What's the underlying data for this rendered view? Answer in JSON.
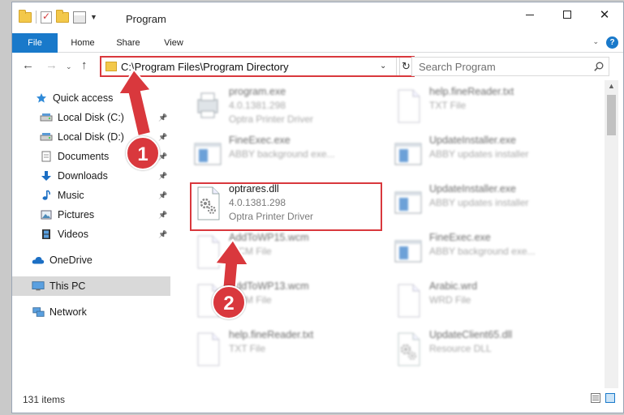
{
  "window": {
    "title": "Program",
    "icons": [
      "folder-icon",
      "properties-check-icon",
      "new-folder-icon",
      "properties-icon",
      "customize-chevron-icon"
    ]
  },
  "ribbon": {
    "tabs": [
      "File",
      "Home",
      "Share",
      "View"
    ],
    "help": "?"
  },
  "address": {
    "path": "C:\\Program Files\\Program Directory",
    "dropdown": "⌄",
    "refresh": "↻"
  },
  "search": {
    "placeholder": "Search Program"
  },
  "sidebar": {
    "items": [
      {
        "label": "Quick access",
        "icon": "star-icon",
        "pinned": false
      },
      {
        "label": "Local Disk (C:)",
        "icon": "drive-icon",
        "pinned": true
      },
      {
        "label": "Local Disk (D:)",
        "icon": "drive-icon",
        "pinned": true
      },
      {
        "label": "Documents",
        "icon": "documents-icon",
        "pinned": true
      },
      {
        "label": "Downloads",
        "icon": "download-arrow-icon",
        "pinned": true
      },
      {
        "label": "Music",
        "icon": "music-note-icon",
        "pinned": true
      },
      {
        "label": "Pictures",
        "icon": "pictures-icon",
        "pinned": true
      },
      {
        "label": "Videos",
        "icon": "video-film-icon",
        "pinned": true
      },
      {
        "label": "OneDrive",
        "icon": "cloud-icon",
        "pinned": false
      },
      {
        "label": "This PC",
        "icon": "computer-icon",
        "pinned": false,
        "selected": true
      },
      {
        "label": "Network",
        "icon": "network-icon",
        "pinned": false
      }
    ]
  },
  "files": [
    {
      "name": "program.exe",
      "version": "4.0.1381.298",
      "desc": "Optra Printer Driver",
      "icon": "printer-exe-icon"
    },
    {
      "name": "help.fineReader.txt",
      "version": "TXT File",
      "desc": "",
      "icon": "text-file-icon"
    },
    {
      "name": "FineExec.exe",
      "version": "ABBY background exe...",
      "desc": "",
      "icon": "app-window-icon"
    },
    {
      "name": "UpdateInstaller.exe",
      "version": "ABBY updates installer",
      "desc": "",
      "icon": "app-window-icon"
    },
    {
      "name": "optrares.dll",
      "version": "4.0.1381.298",
      "desc": "Optra Printer Driver",
      "icon": "dll-gear-icon"
    },
    {
      "name": "UpdateInstaller.exe",
      "version": "ABBY updates installer",
      "desc": "",
      "icon": "app-window-icon"
    },
    {
      "name": "AddToWP15.wcm",
      "version": "WCM File",
      "desc": "",
      "icon": "blank-file-icon"
    },
    {
      "name": "FineExec.exe",
      "version": "ABBY background exe...",
      "desc": "",
      "icon": "app-window-icon"
    },
    {
      "name": "AddToWP13.wcm",
      "version": "WCM File",
      "desc": "",
      "icon": "blank-file-icon"
    },
    {
      "name": "Arabic.wrd",
      "version": "WRD File",
      "desc": "",
      "icon": "blank-file-icon"
    },
    {
      "name": "help.fineReader.txt",
      "version": "TXT File",
      "desc": "",
      "icon": "text-file-icon"
    },
    {
      "name": "UpdateClient65.dll",
      "version": "Resource DLL",
      "desc": "",
      "icon": "dll-gear-icon"
    }
  ],
  "status": {
    "count": "131 items"
  },
  "annotations": {
    "step1": "1",
    "step2": "2"
  },
  "colors": {
    "accent": "#1979ca",
    "highlight": "#d9383d",
    "selected": "#d9d9d9"
  }
}
